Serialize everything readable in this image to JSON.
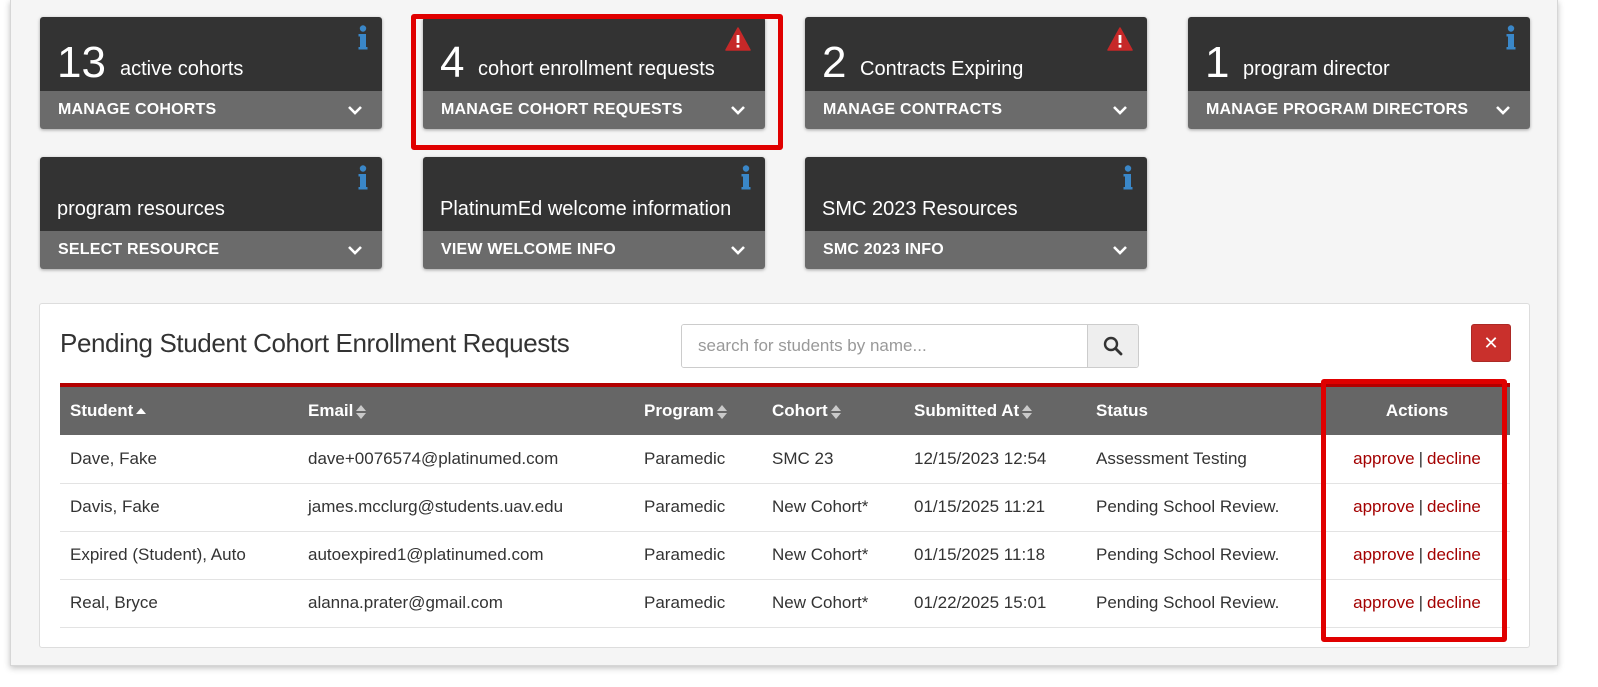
{
  "tiles": [
    {
      "id": "cohorts",
      "count": "13",
      "label": "active cohorts",
      "action": "MANAGE COHORTS",
      "alert": "info"
    },
    {
      "id": "cohort-requests",
      "count": "4",
      "label": "cohort enrollment requests",
      "action": "MANAGE COHORT REQUESTS",
      "alert": "warning"
    },
    {
      "id": "contracts",
      "count": "2",
      "label": "Contracts Expiring",
      "action": "MANAGE CONTRACTS",
      "alert": "warning"
    },
    {
      "id": "program-directors",
      "count": "1",
      "label": "program director",
      "action": "MANAGE PROGRAM DIRECTORS",
      "alert": "info"
    },
    {
      "id": "resources",
      "count": "",
      "label": "program resources",
      "action": "SELECT RESOURCE",
      "alert": "info"
    },
    {
      "id": "welcome",
      "count": "",
      "label": "PlatinumEd welcome information",
      "action": "VIEW WELCOME INFO",
      "alert": "info"
    },
    {
      "id": "smc2023",
      "count": "",
      "label": "SMC 2023 Resources",
      "action": "SMC 2023 INFO",
      "alert": "info"
    }
  ],
  "panel": {
    "title": "Pending Student Cohort Enrollment Requests",
    "search_placeholder": "search for students by name...",
    "close_label": "✕"
  },
  "table": {
    "columns": {
      "student": "Student",
      "email": "Email",
      "program": "Program",
      "cohort": "Cohort",
      "submitted": "Submitted At",
      "status": "Status",
      "actions": "Actions"
    },
    "approve_label": "approve",
    "decline_label": "decline",
    "separator": "|",
    "rows": [
      {
        "student": "Dave, Fake",
        "email": "dave+0076574@platinumed.com",
        "program": "Paramedic",
        "cohort": "SMC 23",
        "submitted": "12/15/2023 12:54",
        "status": "Assessment Testing"
      },
      {
        "student": "Davis, Fake",
        "email": "james.mcclurg@students.uav.edu",
        "program": "Paramedic",
        "cohort": "New Cohort*",
        "submitted": "01/15/2025 11:21",
        "status": "Pending School Review."
      },
      {
        "student": "Expired (Student), Auto",
        "email": "autoexpired1@platinumed.com",
        "program": "Paramedic",
        "cohort": "New Cohort*",
        "submitted": "01/15/2025 11:18",
        "status": "Pending School Review."
      },
      {
        "student": "Real, Bryce",
        "email": "alanna.prater@gmail.com",
        "program": "Paramedic",
        "cohort": "New Cohort*",
        "submitted": "01/22/2025 15:01",
        "status": "Pending School Review."
      }
    ]
  },
  "colors": {
    "tile_top": "#333333",
    "tile_bottom": "#6b6b6b",
    "info": "#3a87c8",
    "warning": "#c62828",
    "highlight": "#e00000",
    "link": "#a30000"
  }
}
